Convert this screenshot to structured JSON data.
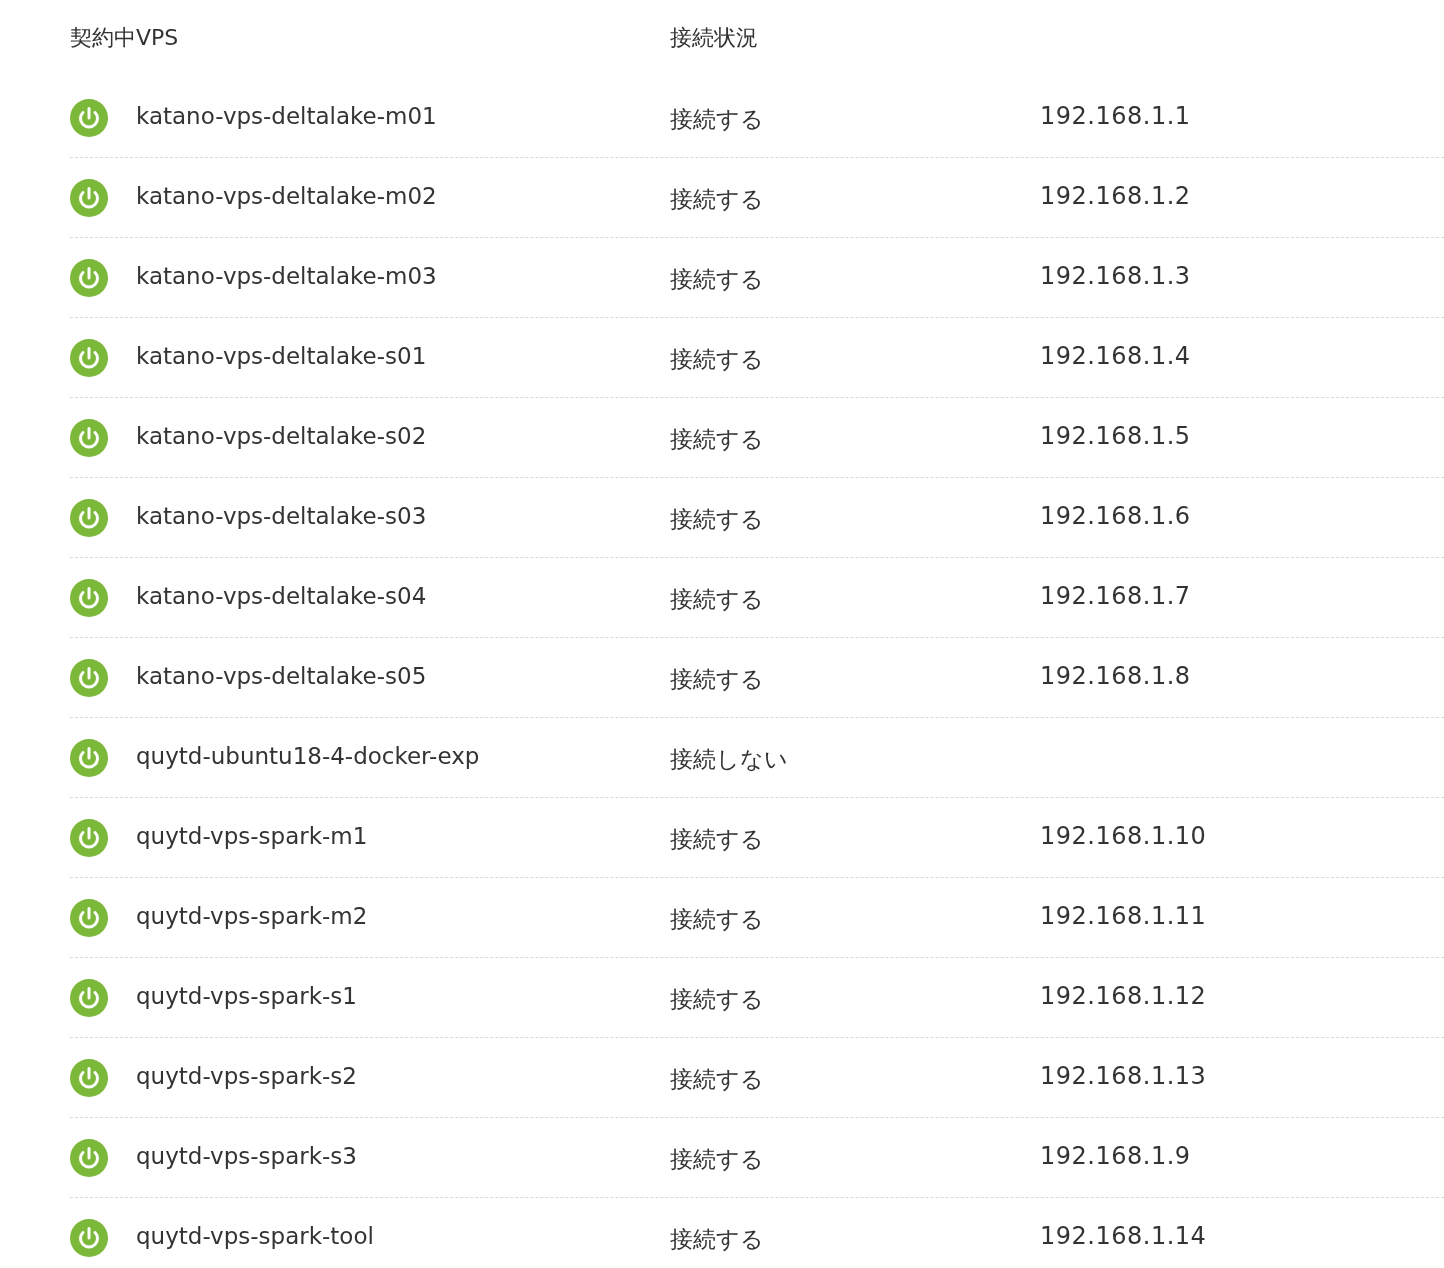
{
  "columns": [
    "契約中VPS",
    "接続状況"
  ],
  "rows": [
    {
      "name": "katano-vps-deltalake-m01",
      "status": "接続する",
      "ip": "192.168.1.1"
    },
    {
      "name": "katano-vps-deltalake-m02",
      "status": "接続する",
      "ip": "192.168.1.2"
    },
    {
      "name": "katano-vps-deltalake-m03",
      "status": "接続する",
      "ip": "192.168.1.3"
    },
    {
      "name": "katano-vps-deltalake-s01",
      "status": "接続する",
      "ip": "192.168.1.4"
    },
    {
      "name": "katano-vps-deltalake-s02",
      "status": "接続する",
      "ip": "192.168.1.5"
    },
    {
      "name": "katano-vps-deltalake-s03",
      "status": "接続する",
      "ip": "192.168.1.6"
    },
    {
      "name": "katano-vps-deltalake-s04",
      "status": "接続する",
      "ip": "192.168.1.7"
    },
    {
      "name": "katano-vps-deltalake-s05",
      "status": "接続する",
      "ip": "192.168.1.8"
    },
    {
      "name": "quytd-ubuntu18-4-docker-exp",
      "status": "接続しない"
    },
    {
      "name": "quytd-vps-spark-m1",
      "status": "接続する",
      "ip": "192.168.1.10"
    },
    {
      "name": "quytd-vps-spark-m2",
      "status": "接続する",
      "ip": "192.168.1.11"
    },
    {
      "name": "quytd-vps-spark-s1",
      "status": "接続する",
      "ip": "192.168.1.12"
    },
    {
      "name": "quytd-vps-spark-s2",
      "status": "接続する",
      "ip": "192.168.1.13"
    },
    {
      "name": "quytd-vps-spark-s3",
      "status": "接続する",
      "ip": "192.168.1.9"
    },
    {
      "name": "quytd-vps-spark-tool",
      "status": "接続する",
      "ip": "192.168.1.14"
    }
  ]
}
